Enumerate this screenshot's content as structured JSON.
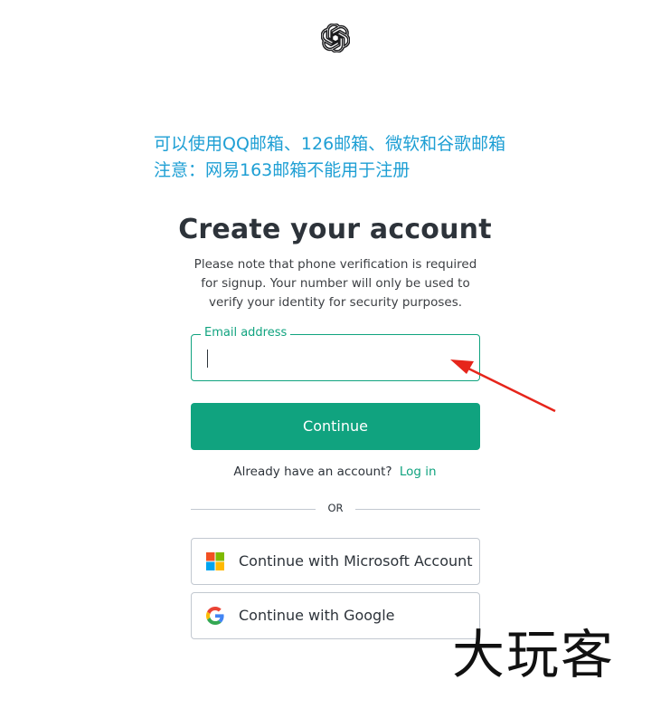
{
  "logo": {
    "icon": "openai-logo-icon"
  },
  "annotation": {
    "line1": "可以使用QQ邮箱、126邮箱、微软和谷歌邮箱",
    "line2": "注意：网易163邮箱不能用于注册",
    "color": "#1e9fd4"
  },
  "page": {
    "title": "Create your account",
    "description": "Please note that phone verification is required for signup. Your number will only be used to verify your identity for security purposes."
  },
  "email": {
    "label": "Email address",
    "value": ""
  },
  "continue_button": {
    "label": "Continue"
  },
  "login": {
    "prompt": "Already have an account?",
    "link": "Log in"
  },
  "divider": {
    "text": "OR"
  },
  "social": {
    "microsoft": {
      "label": "Continue with Microsoft Account",
      "icon": "microsoft-icon"
    },
    "google": {
      "label": "Continue with Google",
      "icon": "google-icon"
    }
  },
  "watermark": {
    "text": "大玩客"
  },
  "colors": {
    "accent": "#10a37f",
    "annotation_arrow": "#e6251b"
  }
}
